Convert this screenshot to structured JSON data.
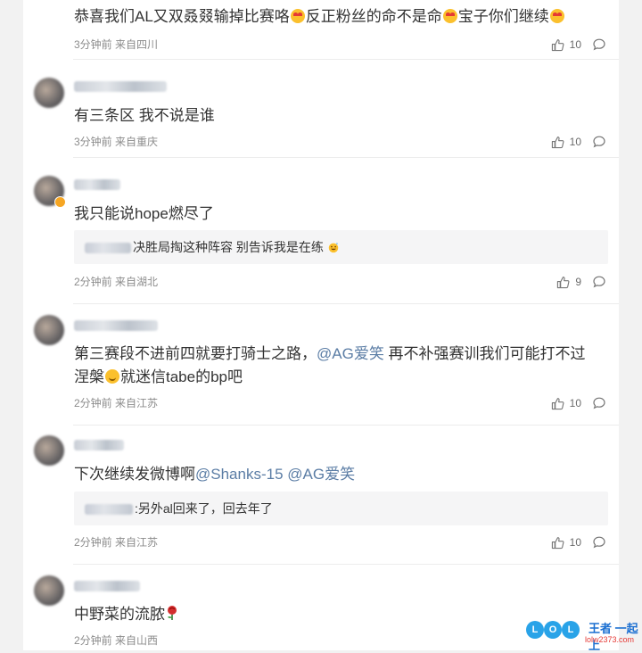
{
  "comments": [
    {
      "segments": [
        {
          "t": "恭喜我们AL又双叒叕输掉比赛咯"
        },
        {
          "emoji": "love"
        },
        {
          "t": "反正粉丝的命不是命"
        },
        {
          "emoji": "love"
        },
        {
          "t": "宝子你们继续"
        },
        {
          "emoji": "love"
        }
      ],
      "meta": "3分钟前 来自四川",
      "likes": "10"
    },
    {
      "segments": [
        {
          "t": "有三条区 我不说是谁"
        }
      ],
      "meta": "3分钟前 来自重庆",
      "likes": "10"
    },
    {
      "segments": [
        {
          "t": "我只能说hope燃尽了"
        }
      ],
      "reply": {
        "text": "决胜局掏这种阵容 别告诉我是在练"
      },
      "meta": "2分钟前 来自湖北",
      "likes": "9"
    },
    {
      "segments": [
        {
          "t": "第三赛段不进前四就要打骑士之路，"
        },
        {
          "m": "@AG爱笑"
        },
        {
          "t": " 再不补强赛训我们可能打不过涅槃"
        },
        {
          "emoji": "smile"
        },
        {
          "t": "就迷信tabe的bp吧"
        }
      ],
      "meta": "2分钟前 来自江苏",
      "likes": "10"
    },
    {
      "segments": [
        {
          "t": "下次继续发微博啊"
        },
        {
          "m": "@Shanks-15"
        },
        {
          "t": " "
        },
        {
          "m": "@AG爱笑"
        }
      ],
      "reply": {
        "text": ":另外al回来了，回去年了"
      },
      "meta": "2分钟前 来自江苏",
      "likes": "10"
    },
    {
      "segments": [
        {
          "t": "中野菜的流脓"
        },
        {
          "emoji": "rose"
        }
      ],
      "meta": "2分钟前 来自山西",
      "likes": ""
    }
  ],
  "icons": {
    "like": "thumbs-up-icon",
    "reply": "speech-bubble-icon"
  },
  "colors": {
    "mention": "#5b7da5",
    "meta": "#8c8c8c",
    "reply_bg": "#f5f5f6"
  },
  "watermark": {
    "letters": [
      "L",
      "O",
      "L"
    ],
    "brand": "王者 一起上",
    "url": "lolw2373.com"
  }
}
